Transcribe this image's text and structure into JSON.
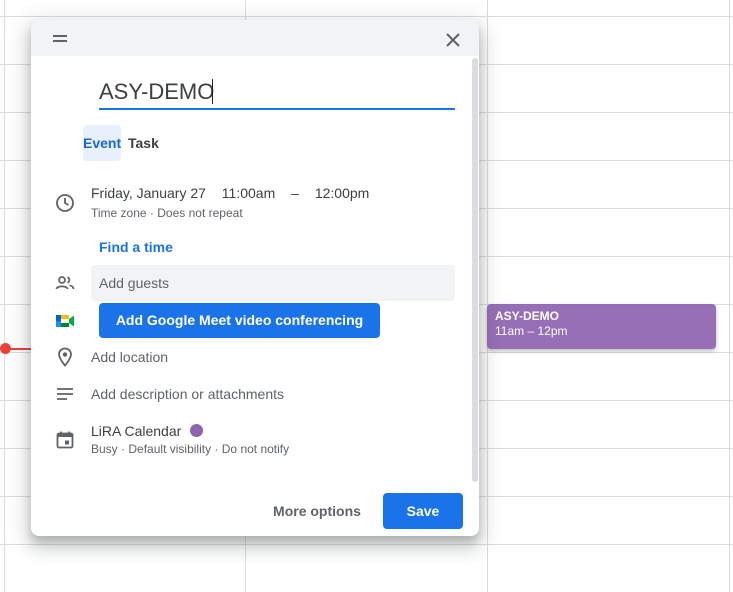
{
  "dialog": {
    "title_value": "ASY-DEMO",
    "tabs": [
      {
        "label": "Event",
        "active": true
      },
      {
        "label": "Task",
        "active": false
      }
    ],
    "date": {
      "day": "Friday, January 27",
      "start": "11:00am",
      "separator": "–",
      "end": "12:00pm",
      "timezone": "Time zone",
      "recurrence": "Does not repeat"
    },
    "find_time": "Find a time",
    "guests_placeholder": "Add guests",
    "meet_button": "Add Google Meet video conferencing",
    "location": "Add location",
    "description": "Add description or attachments",
    "calendar": {
      "name": "LiRA Calendar",
      "color": "#8e63b0",
      "busy": "Busy",
      "visibility": "Default visibility",
      "notify": "Do not notify"
    },
    "more_options": "More options",
    "save": "Save"
  },
  "event_chip": {
    "title": "ASY-DEMO",
    "time": "11am – 12pm",
    "color": "#8e63b0"
  },
  "colors": {
    "accent": "#1a73e8",
    "now_indicator": "#ea4335"
  },
  "separator_dot": "·"
}
